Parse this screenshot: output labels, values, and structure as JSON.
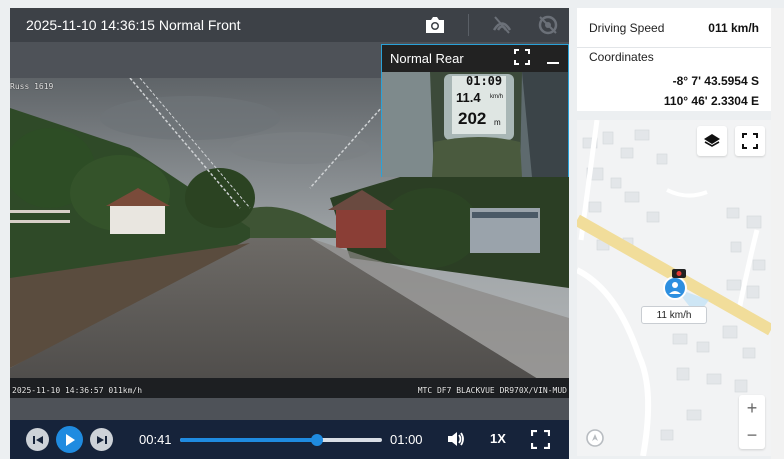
{
  "video": {
    "title": "2025-11-10 14:36:15 Normal Front",
    "osd_top_left": "Russ 1619",
    "osd_bottom_left": "2025-11-10 14:36:57 011km/h",
    "osd_bottom_right": "MTC DF7 BLACKVUE DR970X/VIN-MUD",
    "rear_title": "Normal Rear",
    "gps_time": "01:09",
    "gps_speed": "11.4",
    "gps_speed_unit": "km/h",
    "gps_dist": "202",
    "gps_dist_unit": "m"
  },
  "player": {
    "current_time": "00:41",
    "duration": "01:00",
    "progress": 0.68,
    "speed": "1X"
  },
  "info": {
    "speed_label": "Driving Speed",
    "speed_value": "011 km/h",
    "coords_label": "Coordinates",
    "latitude": "-8° 7' 43.5954 S",
    "longitude": "110° 46' 2.3304 E"
  },
  "map": {
    "speed_tag": "11 km/h",
    "zoom_in": "+",
    "zoom_out": "−",
    "road_color": "#f1dd9a",
    "marker_color": "#2d8fe0"
  }
}
